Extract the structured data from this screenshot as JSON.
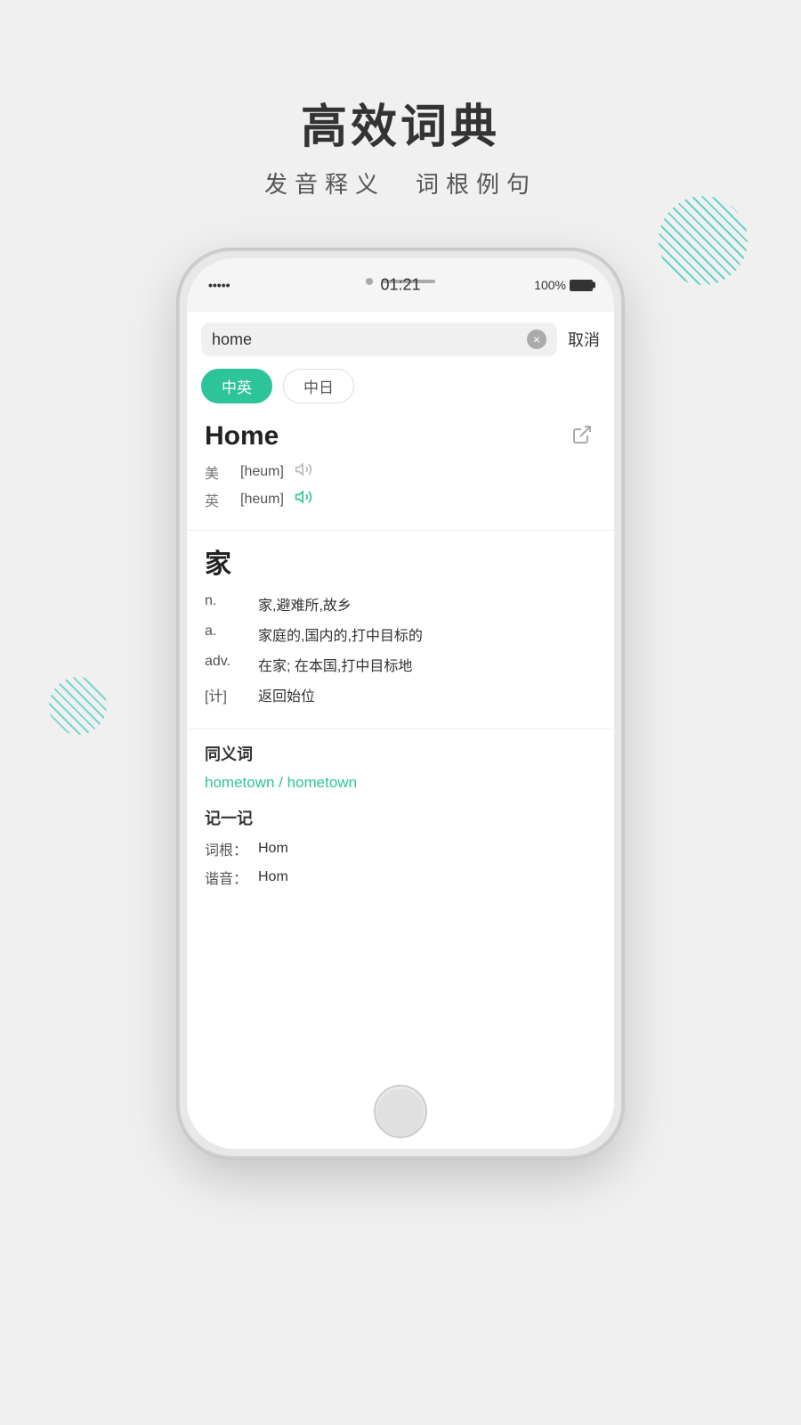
{
  "page": {
    "title": "高效词典",
    "subtitle": "发音释义　词根例句"
  },
  "status_bar": {
    "signal": "•••••",
    "time": "01:21",
    "battery": "100%"
  },
  "search": {
    "query": "home",
    "cancel_label": "取消",
    "clear_icon": "×"
  },
  "tabs": [
    {
      "label": "中英",
      "active": true
    },
    {
      "label": "中日",
      "active": false
    }
  ],
  "dictionary": {
    "word": "Home",
    "pronunciations": [
      {
        "region": "美",
        "phonetic": "[heum]",
        "audio": true,
        "active": false
      },
      {
        "region": "英",
        "phonetic": "[heum]",
        "audio": true,
        "active": true
      }
    ],
    "chinese_translation": "家",
    "definitions": [
      {
        "pos": "n.",
        "text": "家,避难所,故乡"
      },
      {
        "pos": "a.",
        "text": "家庭的,国内的,打中目标的"
      },
      {
        "pos": "adv.",
        "text": "在家; 在本国,打中目标地"
      },
      {
        "pos": "[计]",
        "text": "返回始位"
      }
    ],
    "synonyms_title": "同义词",
    "synonyms": "hometown / hometown",
    "memory_title": "记一记",
    "memory_root_label": "词根：",
    "memory_root_value": "Hom",
    "memory_sound_label": "谐音：",
    "memory_sound_value": "Hom"
  }
}
